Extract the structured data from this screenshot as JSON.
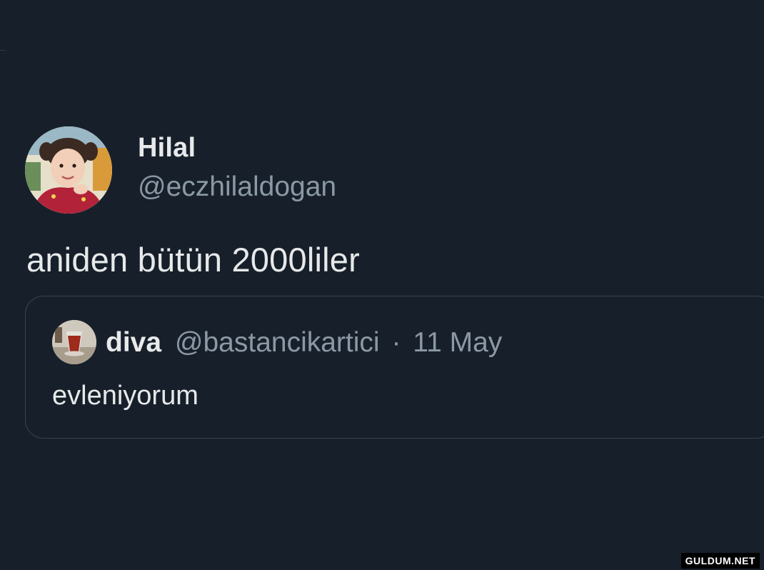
{
  "tweet": {
    "author_name": "Hilal",
    "author_handle": "@eczhilaldogan",
    "text": "aniden bütün 2000liler",
    "avatar_icon": "profile-photo-child",
    "quote": {
      "name": "diva",
      "handle": "@bastancikartici",
      "separator": "·",
      "date": "11 May",
      "text": "evleniyorum",
      "avatar_icon": "profile-photo-tea-glass"
    }
  },
  "watermark": "GULDUM.NET",
  "colors": {
    "background": "#17202a",
    "primary_text": "#e7e9ea",
    "secondary_text": "#8b98a5",
    "border": "#38444d"
  }
}
